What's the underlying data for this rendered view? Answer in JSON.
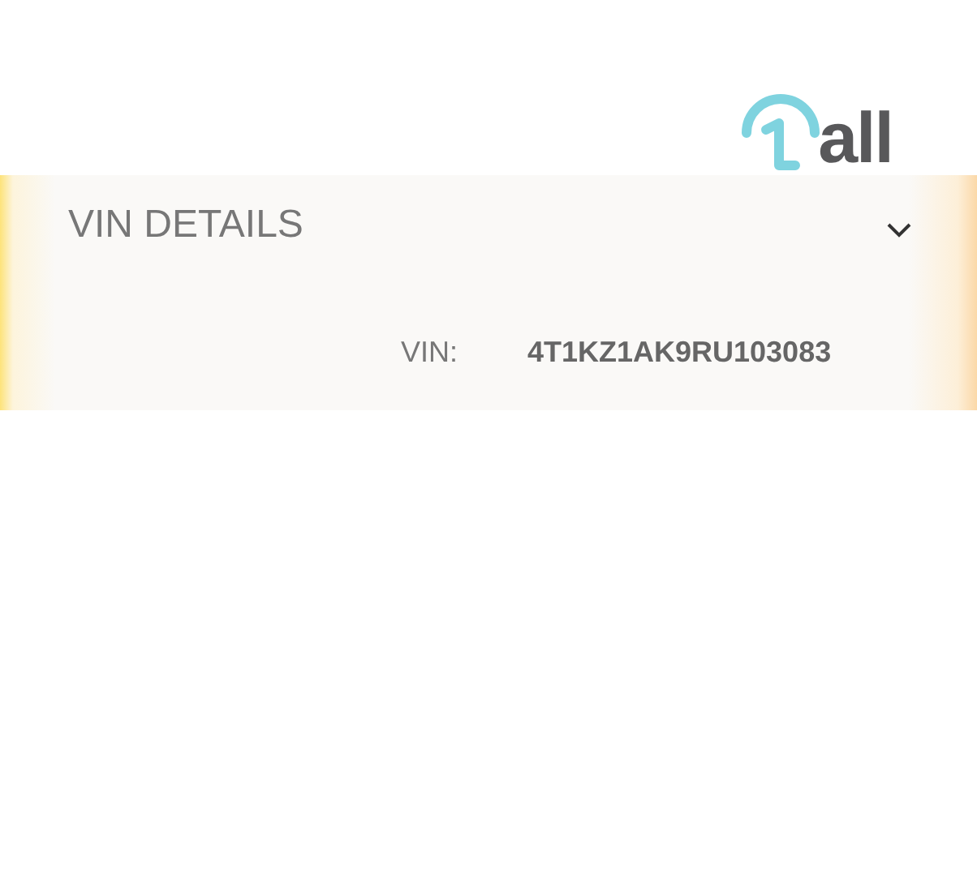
{
  "logo": {
    "text": "all"
  },
  "section": {
    "title": "VIN DETAILS",
    "fields": [
      {
        "label": "VIN:",
        "value": "4T1KZ1AK9RU103083"
      }
    ]
  }
}
